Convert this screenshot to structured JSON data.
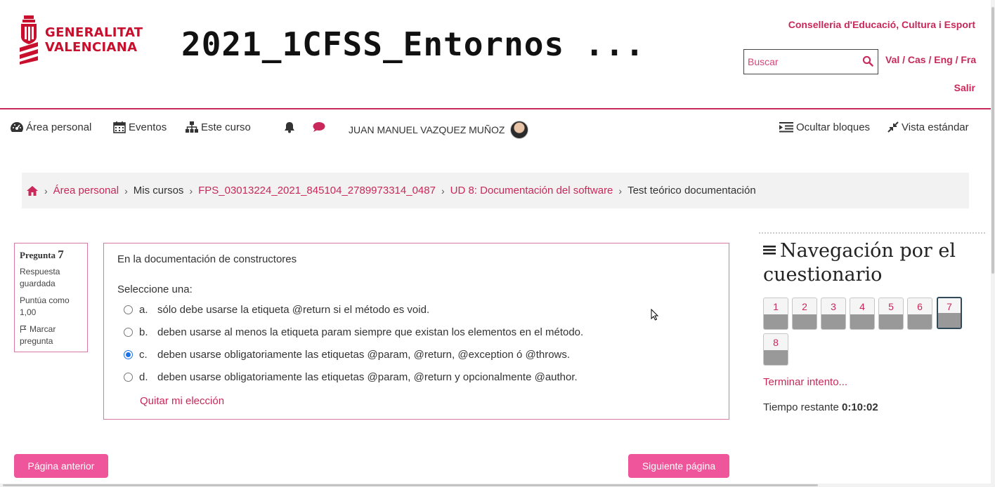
{
  "header": {
    "logo_line1": "GENERALITAT",
    "logo_line2": "VALENCIANA",
    "course_title": "2021_1CFSS_Entornos ...",
    "conselleria": "Conselleria d'Educació, Cultura i Esport",
    "search_placeholder": "Buscar",
    "languages": "Val / Cas / Eng / Fra",
    "logout": "Salir",
    "brand_color": "#c8285a"
  },
  "navbar": {
    "area_personal": "Área personal",
    "eventos": "Eventos",
    "este_curso": "Este curso",
    "user_name": "JUAN MANUEL VAZQUEZ MUÑOZ",
    "hide_blocks": "Ocultar bloques",
    "standard_view": "Vista estándar"
  },
  "breadcrumb": {
    "home_icon": "home-icon",
    "items": [
      "Área personal",
      "Mis cursos",
      "FPS_03013224_2021_845104_2789973314_0487",
      "UD 8: Documentación del software",
      "Test teórico documentación"
    ]
  },
  "question_info": {
    "label": "Pregunta",
    "number": "7",
    "status": "Respuesta guardada",
    "grade": "Puntúa como 1,00",
    "flag": "Marcar pregunta"
  },
  "question": {
    "text": "En la documentación de constructores",
    "prompt": "Seleccione una:",
    "options": [
      {
        "letter": "a.",
        "text": "sólo debe usarse la etiqueta @return si el método es void.",
        "checked": false
      },
      {
        "letter": "b.",
        "text": "deben usarse al menos la etiqueta param siempre que existan los elementos en el método.",
        "checked": false
      },
      {
        "letter": "c.",
        "text": "deben usarse obligatoriamente las etiquetas @param, @return, @exception ó @throws.",
        "checked": true
      },
      {
        "letter": "d.",
        "text": "deben usarse obligatoriamente las etiquetas @param, @return y opcionalmente @author.",
        "checked": false
      }
    ],
    "clear_choice": "Quitar mi elección"
  },
  "quiz_nav": {
    "heading": "Navegación por el cuestionario",
    "questions": [
      "1",
      "2",
      "3",
      "4",
      "5",
      "6",
      "7",
      "8"
    ],
    "current": "7",
    "finish": "Terminar intento...",
    "time_label": "Tiempo restante",
    "time_value": "0:10:02"
  },
  "buttons": {
    "previous": "Página anterior",
    "next": "Siguiente página",
    "button_color": "#ef559a"
  }
}
